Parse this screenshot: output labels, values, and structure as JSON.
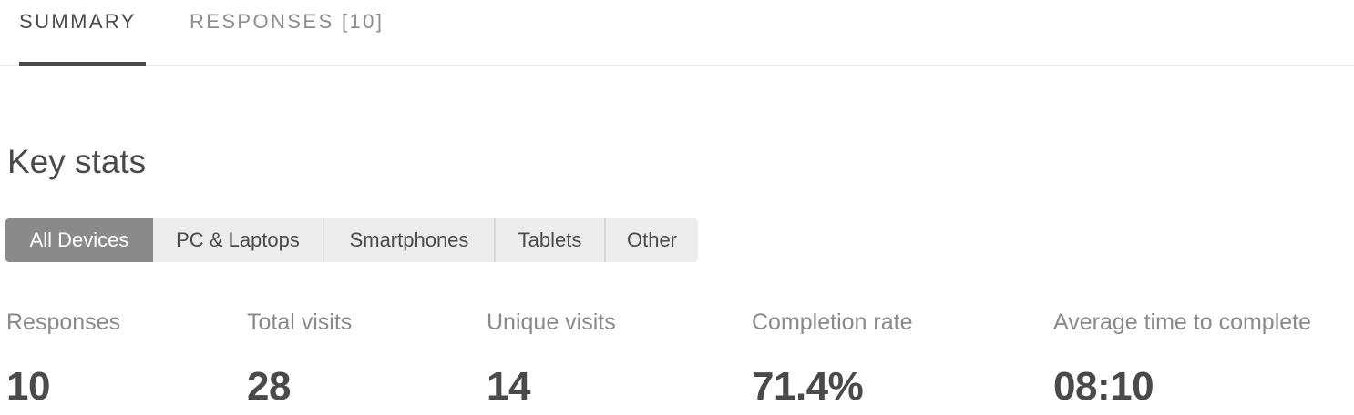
{
  "tabs": {
    "summary": "SUMMARY",
    "responses": "RESPONSES [10]",
    "active": "summary"
  },
  "section": {
    "title": "Key stats"
  },
  "device_filter": {
    "selected": "All Devices",
    "options": [
      "All Devices",
      "PC & Laptops",
      "Smartphones",
      "Tablets",
      "Other"
    ]
  },
  "stats": [
    {
      "label": "Responses",
      "value": "10"
    },
    {
      "label": "Total visits",
      "value": "28"
    },
    {
      "label": "Unique visits",
      "value": "14"
    },
    {
      "label": "Completion rate",
      "value": "71.4%"
    },
    {
      "label": "Average time to complete",
      "value": "08:10"
    }
  ],
  "colors": {
    "text_primary": "#4a4a4a",
    "text_muted": "#8a8a8a",
    "segment_bg": "#ececec",
    "segment_active_bg": "#8a8a8a",
    "divider": "#e6e6e6"
  }
}
